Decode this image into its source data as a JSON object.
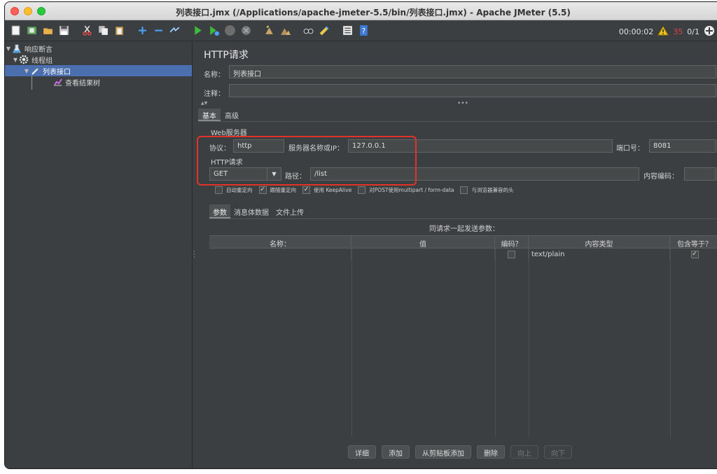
{
  "window": {
    "title": "列表接口.jmx (/Applications/apache-jmeter-5.5/bin/列表接口.jmx) - Apache JMeter (5.5)"
  },
  "toolbar": {
    "icons": [
      "new-icon",
      "templates-icon",
      "open-icon",
      "save-icon",
      "cut-icon",
      "copy-icon",
      "paste-icon",
      "expand-icon",
      "collapse-icon",
      "toggle-icon",
      "start-icon",
      "start-no-pause-icon",
      "stop-icon",
      "shutdown-icon",
      "clear-icon",
      "clear-all-icon",
      "search-icon",
      "reset-search-icon",
      "function-helper-icon",
      "help-icon"
    ],
    "timer": "00:00:02",
    "warning_count": "35",
    "threads": "0/1"
  },
  "tree": {
    "items": [
      {
        "label": "响应断言",
        "icon": "test-plan-icon"
      },
      {
        "label": "线程组",
        "icon": "thread-group-gear-icon"
      },
      {
        "label": "列表接口",
        "icon": "sampler-pipette-icon"
      },
      {
        "label": "查看结果树",
        "icon": "listener-chart-icon"
      }
    ]
  },
  "panel": {
    "title": "HTTP请求",
    "name_label": "名称：",
    "name_value": "列表接口",
    "comment_label": "注释："
  },
  "tabs": {
    "basic": "基本",
    "advanced": "高级"
  },
  "web_server": {
    "group_title": "Web服务器",
    "protocol_label": "协议：",
    "protocol_value": "http",
    "server_label": "服务器名称或IP：",
    "server_value": "127.0.0.1",
    "port_label": "端口号：",
    "port_value": "8081"
  },
  "http_request": {
    "group_title": "HTTP请求",
    "method": "GET",
    "path_label": "路径：",
    "path_value": "/list",
    "encoding_label": "内容编码："
  },
  "options": [
    {
      "label": "自动重定向",
      "checked": false
    },
    {
      "label": "跟随重定向",
      "checked": true
    },
    {
      "label": "使用 KeepAlive",
      "checked": true
    },
    {
      "label": "对POST使用multipart / form-data",
      "checked": false
    },
    {
      "label": "与浏览器兼容的头",
      "checked": false
    }
  ],
  "subtabs": {
    "params": "参数",
    "body": "消息体数据",
    "files": "文件上传"
  },
  "params_table": {
    "caption": "同请求一起发送参数：",
    "headers": [
      "名称：",
      "值",
      "编码？",
      "内容类型",
      "包含等于？"
    ],
    "rows": [
      {
        "name": "",
        "value": "",
        "encode": false,
        "content_type": "text/plain",
        "include_equals": true
      }
    ]
  },
  "buttons": {
    "detail": "详细",
    "add": "添加",
    "add_clipboard": "从剪贴板添加",
    "delete": "删除",
    "up": "向上",
    "down": "向下"
  },
  "colors": {
    "accent_selection": "#4b6eaf",
    "highlight_box": "#e0332a",
    "background": "#3c3f41"
  }
}
